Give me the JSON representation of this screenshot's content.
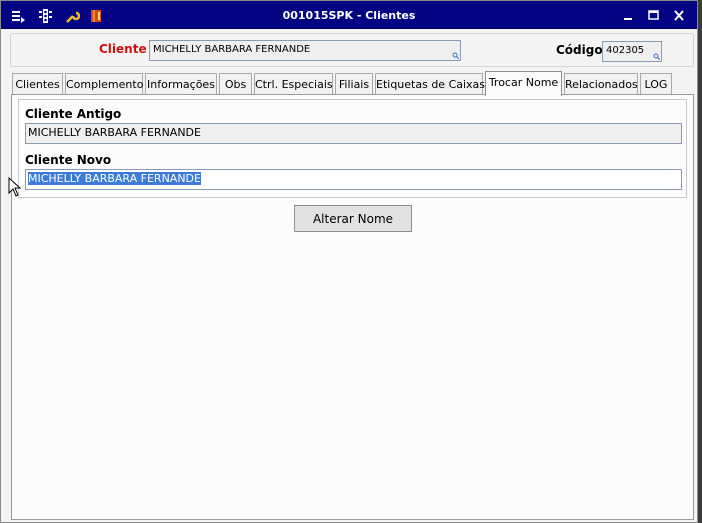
{
  "window": {
    "title": "001015SPK - Clientes",
    "titlebar_icons": [
      "menu-icon",
      "traffic-light-icon",
      "wrench-icon",
      "book-icon"
    ],
    "controls": [
      "minimize-icon",
      "maximize-icon",
      "close-icon"
    ]
  },
  "header": {
    "cliente_label": "Cliente",
    "cliente_value": "MICHELLY BARBARA FERNANDE",
    "codigo_label": "Código",
    "codigo_value": "402305"
  },
  "tabs": [
    {
      "label": "Clientes",
      "active": false
    },
    {
      "label": "Complemento",
      "active": false
    },
    {
      "label": "Informações",
      "active": false
    },
    {
      "label": "Obs",
      "active": false
    },
    {
      "label": "Ctrl. Especiais",
      "active": false
    },
    {
      "label": "Filiais",
      "active": false
    },
    {
      "label": "Etiquetas de Caixas",
      "active": false
    },
    {
      "label": "Trocar Nome",
      "active": true
    },
    {
      "label": "Relacionados",
      "active": false
    },
    {
      "label": "LOG",
      "active": false
    }
  ],
  "rename": {
    "old_label": "Cliente Antigo",
    "old_value": "MICHELLY BARBARA FERNANDE",
    "new_label": "Cliente Novo",
    "new_value": "MICHELLY BARBARA FERNANDE",
    "button_label": "Alterar Nome"
  },
  "colors": {
    "titlebar": "#030383",
    "cliente_label": "#d21010",
    "selection": "#3d7bd6"
  }
}
